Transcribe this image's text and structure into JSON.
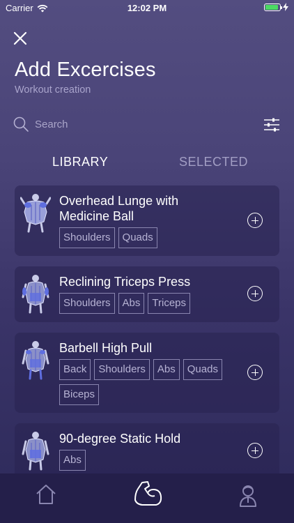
{
  "status_bar": {
    "carrier": "Carrier",
    "time": "12:02 PM",
    "battery_level": 0.9
  },
  "header": {
    "title": "Add Excercises",
    "subtitle": "Workout creation"
  },
  "search": {
    "placeholder": "Search"
  },
  "tabs": {
    "library": "LIBRARY",
    "selected": "SELECTED",
    "active": "library"
  },
  "exercises": [
    {
      "title": "Overhead Lunge with Medicine Ball",
      "tags": [
        "Shoulders",
        "Quads"
      ]
    },
    {
      "title": "Reclining Triceps Press",
      "tags": [
        "Shoulders",
        "Abs",
        "Triceps"
      ]
    },
    {
      "title": "Barbell High Pull",
      "tags": [
        "Back",
        "Shoulders",
        "Abs",
        "Quads",
        "Biceps"
      ]
    },
    {
      "title": "90-degree Static Hold",
      "tags": [
        "Abs"
      ]
    }
  ],
  "tabbar": {
    "icons": [
      "home-icon",
      "flexed-arm-icon",
      "trainer-icon"
    ]
  },
  "colors": {
    "accent": "#ffffff",
    "muted": "#a29ec4",
    "battery": "#4cd964"
  }
}
